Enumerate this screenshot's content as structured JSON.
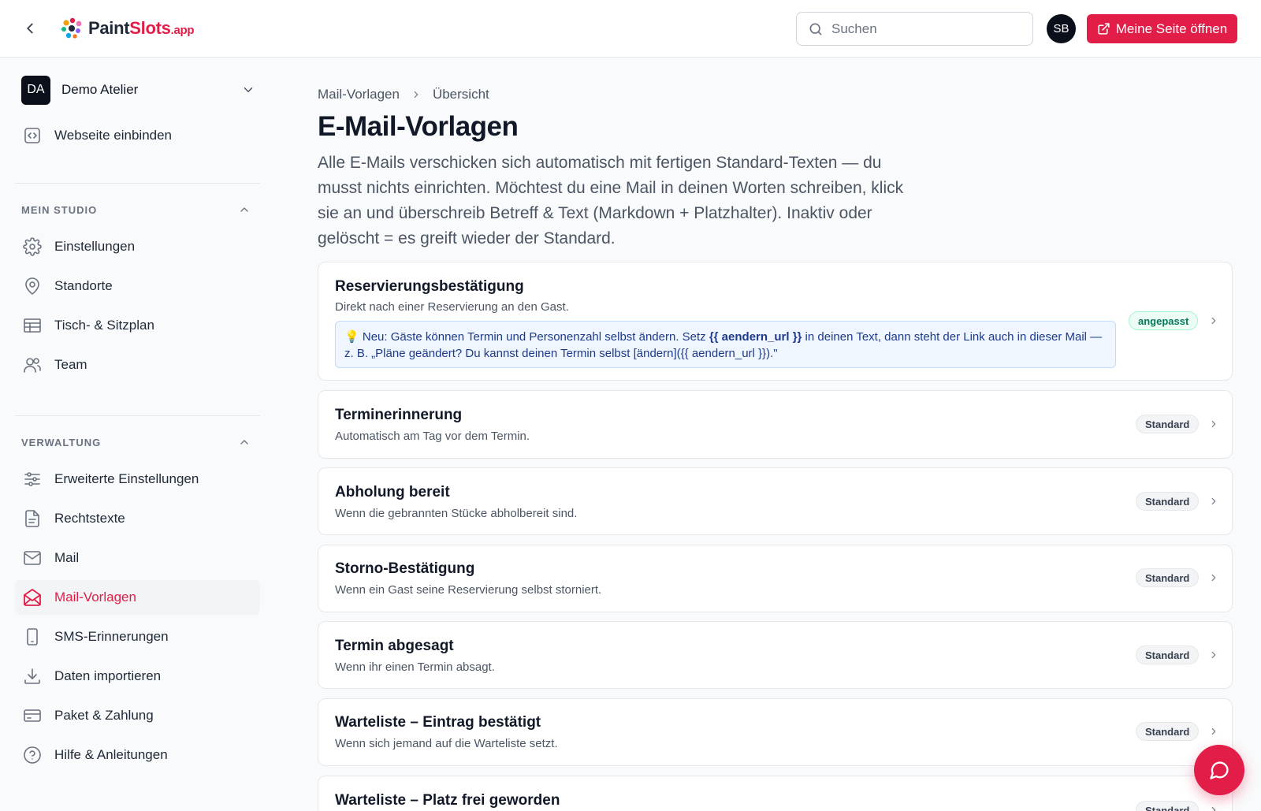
{
  "header": {
    "logo": {
      "paint": "Paint",
      "slots": "Slots",
      "app": ".app"
    },
    "search_placeholder": "Suchen",
    "avatar_initials": "SB",
    "open_site_label": "Meine Seite öffnen",
    "brand_color": "#e11d48"
  },
  "sidebar": {
    "workspace": {
      "initials": "DA",
      "name": "Demo Atelier"
    },
    "top_items": [
      {
        "label": "Webseite einbinden",
        "icon": "code-icon"
      }
    ],
    "sections": [
      {
        "title": "MEIN STUDIO",
        "items": [
          {
            "label": "Einstellungen",
            "icon": "gear-icon"
          },
          {
            "label": "Standorte",
            "icon": "map-pin-icon"
          },
          {
            "label": "Tisch- & Sitzplan",
            "icon": "table-icon"
          },
          {
            "label": "Team",
            "icon": "users-icon"
          }
        ]
      },
      {
        "title": "VERWALTUNG",
        "items": [
          {
            "label": "Erweiterte Einstellungen",
            "icon": "sliders-icon"
          },
          {
            "label": "Rechtstexte",
            "icon": "document-icon"
          },
          {
            "label": "Mail",
            "icon": "mail-icon"
          },
          {
            "label": "Mail-Vorlagen",
            "icon": "mail-open-icon",
            "active": true
          },
          {
            "label": "SMS-Erinnerungen",
            "icon": "phone-icon"
          },
          {
            "label": "Daten importieren",
            "icon": "download-icon"
          },
          {
            "label": "Paket & Zahlung",
            "icon": "credit-card-icon"
          },
          {
            "label": "Hilfe & Anleitungen",
            "icon": "help-icon"
          }
        ]
      }
    ]
  },
  "main": {
    "breadcrumb": [
      "Mail-Vorlagen",
      "Übersicht"
    ],
    "title": "E-Mail-Vorlagen",
    "intro": "Alle E-Mails verschicken sich automatisch mit fertigen Standard-Texten — du musst nichts einrichten. Möchtest du eine Mail in deinen Worten schreiben, klick sie an und überschreib Betreff & Text (Markdown + Platzhalter). Inaktiv oder gelöscht = es greift wieder der Standard.",
    "templates": [
      {
        "title": "Reservierungsbestätigung",
        "description": "Direkt nach einer Reservierung an den Gast.",
        "badge": "angepasst",
        "note": {
          "emoji": "💡",
          "before": " Neu: Gäste können Termin und Personenzahl selbst ändern. Setz ",
          "code": "{{ aendern_url }}",
          "after": " in deinen Text, dann steht der Link auch in dieser Mail — z. B. „Pläne geändert? Du kannst deinen Termin selbst [ändern]({{ aendern_url }}).\""
        }
      },
      {
        "title": "Terminerinnerung",
        "description": "Automatisch am Tag vor dem Termin.",
        "badge": "Standard"
      },
      {
        "title": "Abholung bereit",
        "description": "Wenn die gebrannten Stücke abholbereit sind.",
        "badge": "Standard"
      },
      {
        "title": "Storno-Bestätigung",
        "description": "Wenn ein Gast seine Reservierung selbst storniert.",
        "badge": "Standard"
      },
      {
        "title": "Termin abgesagt",
        "description": "Wenn ihr einen Termin absagt.",
        "badge": "Standard"
      },
      {
        "title": "Warteliste – Eintrag bestätigt",
        "description": "Wenn sich jemand auf die Warteliste setzt.",
        "badge": "Standard"
      },
      {
        "title": "Warteliste – Platz frei geworden",
        "description": "",
        "badge": "Standard"
      }
    ]
  }
}
